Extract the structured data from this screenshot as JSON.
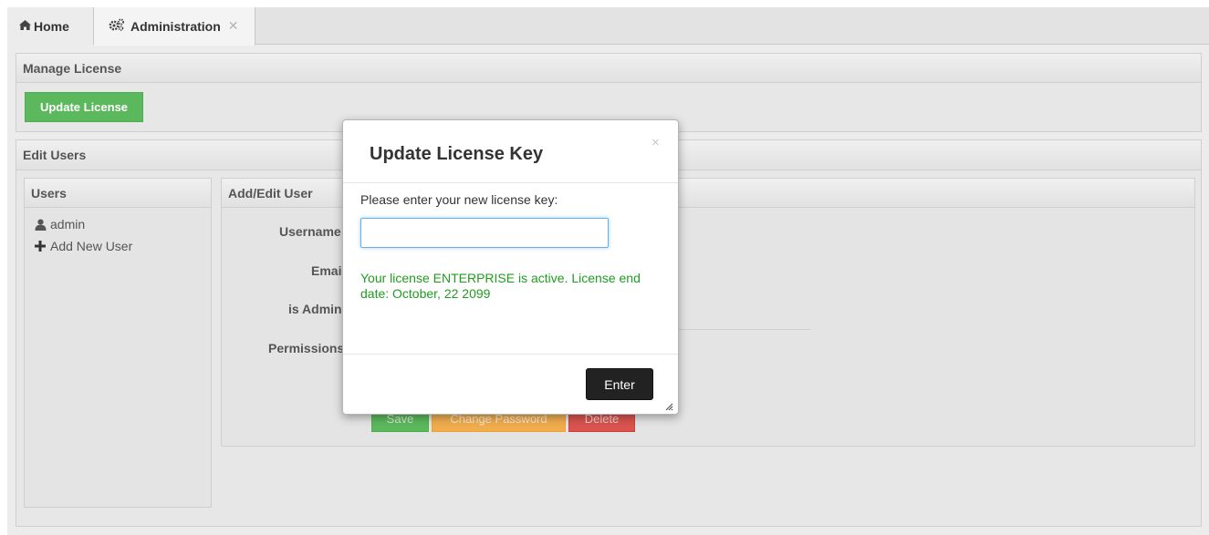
{
  "tabs": [
    {
      "label": "Home",
      "icon": "home-icon"
    },
    {
      "label": "Administration",
      "icon": "cogs-icon",
      "close": "✕"
    }
  ],
  "manage_license": {
    "title": "Manage License",
    "update_button": "Update License"
  },
  "edit_users": {
    "title": "Edit Users",
    "users_panel": {
      "title": "Users",
      "items": [
        {
          "label": "admin",
          "icon": "user-icon"
        },
        {
          "label": "Add New User",
          "icon": "plus-icon"
        }
      ]
    },
    "form": {
      "title": "Add/Edit User",
      "labels": {
        "username": "Username",
        "email": "Email",
        "is_admin": "is Admin",
        "permissions": "Permissions"
      },
      "buttons": {
        "save": "Save",
        "change_password": "Change Password",
        "delete": "Delete"
      }
    }
  },
  "modal": {
    "title": "Update License Key",
    "close": "×",
    "prompt": "Please enter your new license key:",
    "input_value": "",
    "status": "Your license ENTERPRISE is active. License end date: October, 22 2099",
    "enter_button": "Enter"
  },
  "colors": {
    "success_green": "#5cb85c",
    "warning_orange": "#f0ad4e",
    "danger_red": "#d9534f",
    "status_text_green": "#1f9d1f",
    "dark_button": "#222222"
  }
}
